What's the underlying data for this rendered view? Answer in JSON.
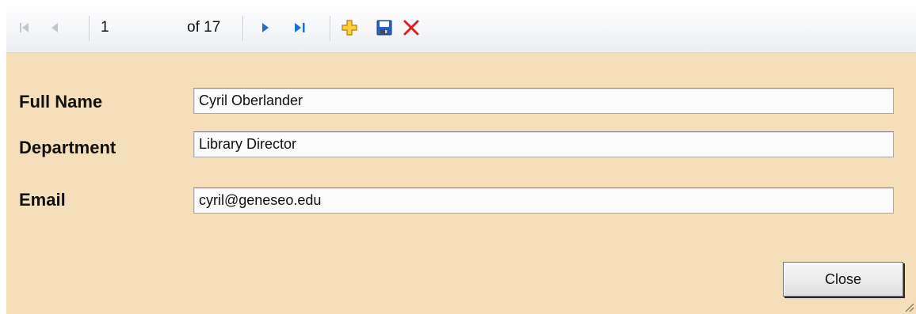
{
  "navigator": {
    "position": "1",
    "count_label": "of 17",
    "icons": {
      "first": "move-first-icon",
      "previous": "move-previous-icon",
      "next": "move-next-icon",
      "last": "move-last-icon",
      "add": "add-new-icon",
      "save": "save-icon",
      "delete": "delete-icon"
    }
  },
  "form": {
    "full_name": {
      "label": "Full Name",
      "value": "Cyril Oberlander"
    },
    "department": {
      "label": "Department",
      "value": "Library Director"
    },
    "email": {
      "label": "Email",
      "value": "cyril@geneseo.edu"
    }
  },
  "close_button": {
    "label": "Close"
  },
  "colors": {
    "form_background": "#f5dfbb",
    "toolbar_background": "#f4f5f7",
    "nav_disabled": "#c3c7cf",
    "nav_enabled": "#1b6fd1",
    "add_icon": "#f0c020",
    "save_icon": "#2a5fc4",
    "delete_icon": "#e02020"
  }
}
